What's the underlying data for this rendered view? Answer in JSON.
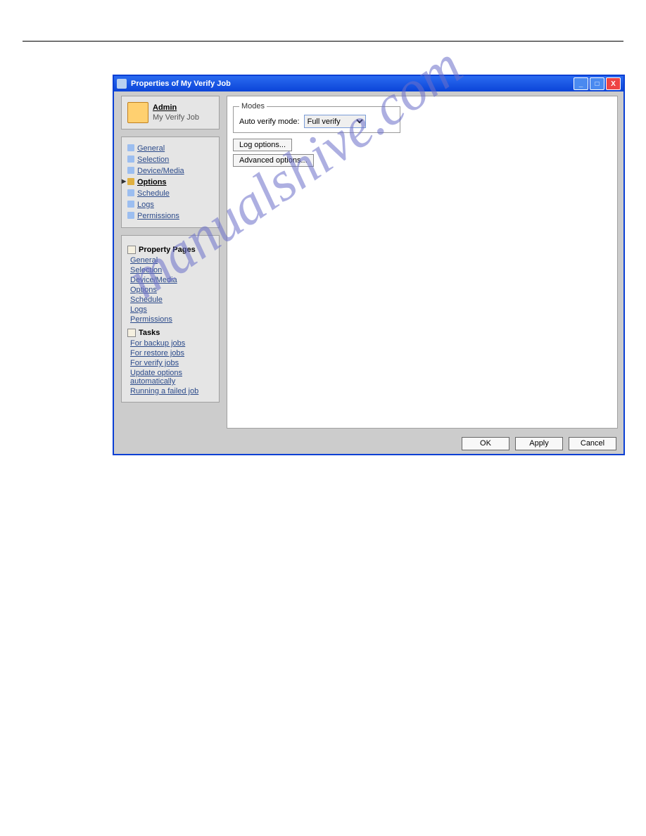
{
  "watermark": "manualshive.com",
  "window": {
    "title": "Properties of My Verify Job"
  },
  "header": {
    "admin_label": "Admin",
    "job_name": "My Verify Job"
  },
  "nav": {
    "items": [
      {
        "label": "General"
      },
      {
        "label": "Selection"
      },
      {
        "label": "Device/Media"
      },
      {
        "label": "Options"
      },
      {
        "label": "Schedule"
      },
      {
        "label": "Logs"
      },
      {
        "label": "Permissions"
      }
    ]
  },
  "property_pages": {
    "heading": "Property Pages",
    "links": [
      "General",
      "Selection",
      "Device/Media",
      "Options",
      "Schedule",
      "Logs",
      "Permissions"
    ]
  },
  "tasks": {
    "heading": "Tasks",
    "links": [
      "For backup jobs",
      "For restore jobs",
      "For verify jobs",
      "Update options automatically",
      "Running a failed job"
    ]
  },
  "options": {
    "modes_legend": "Modes",
    "auto_verify_label": "Auto verify mode:",
    "auto_verify_value": "Full verify",
    "log_options_btn": "Log options...",
    "adv_options_btn": "Advanced options..."
  },
  "footer": {
    "ok": "OK",
    "apply": "Apply",
    "cancel": "Cancel"
  }
}
